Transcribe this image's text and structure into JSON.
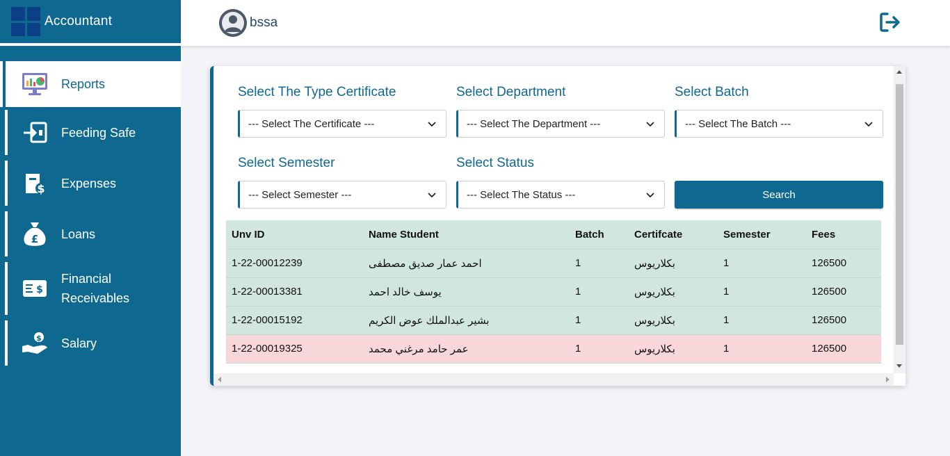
{
  "app": {
    "title": "Accountant"
  },
  "user": {
    "name": "bssa"
  },
  "sidebar": {
    "items": [
      {
        "label": "Reports",
        "icon": "reports-icon",
        "active": true
      },
      {
        "label": "Feeding Safe",
        "icon": "feeding-safe-icon"
      },
      {
        "label": "Expenses",
        "icon": "expenses-icon"
      },
      {
        "label": "Loans",
        "icon": "loans-icon"
      },
      {
        "label": "Financial Receivables",
        "icon": "financial-receivables-icon"
      },
      {
        "label": "Salary",
        "icon": "salary-icon"
      }
    ]
  },
  "filters": {
    "certificate": {
      "label": "Select The Type Certificate",
      "value": "--- Select The Certificate ---"
    },
    "department": {
      "label": "Select Department",
      "value": "--- Select The Department ---"
    },
    "batch": {
      "label": "Select Batch",
      "value": "--- Select The Batch ---"
    },
    "semester": {
      "label": "Select Semester",
      "value": "--- Select Semester ---"
    },
    "status": {
      "label": "Select Status",
      "value": "--- Select The Status ---"
    },
    "search_label": "Search"
  },
  "table": {
    "headers": [
      "Unv ID",
      "Name Student",
      "Batch",
      "Certifcate",
      "Semester",
      "Fees"
    ],
    "rows": [
      {
        "id": "1-22-00012239",
        "name": "احمد عمار صديق مصطفى",
        "batch": "1",
        "certificate": "بكلاريوس",
        "semester": "1",
        "fees": "126500",
        "status": "green"
      },
      {
        "id": "1-22-00013381",
        "name": "يوسف خالد احمد",
        "batch": "1",
        "certificate": "بكلاريوس",
        "semester": "1",
        "fees": "126500",
        "status": "green"
      },
      {
        "id": "1-22-00015192",
        "name": "بشير عبدالملك عوض الكريم",
        "batch": "1",
        "certificate": "بكلاريوس",
        "semester": "1",
        "fees": "126500",
        "status": "green"
      },
      {
        "id": "1-22-00019325",
        "name": "عمر حامد مرغني محمد",
        "batch": "1",
        "certificate": "بكلاريوس",
        "semester": "1",
        "fees": "126500",
        "status": "red"
      }
    ]
  },
  "colors": {
    "primary": "#0f6890",
    "logo": "#0b3f86",
    "row_paid": "#d1e6dc",
    "row_unpaid": "#f8d7da"
  }
}
